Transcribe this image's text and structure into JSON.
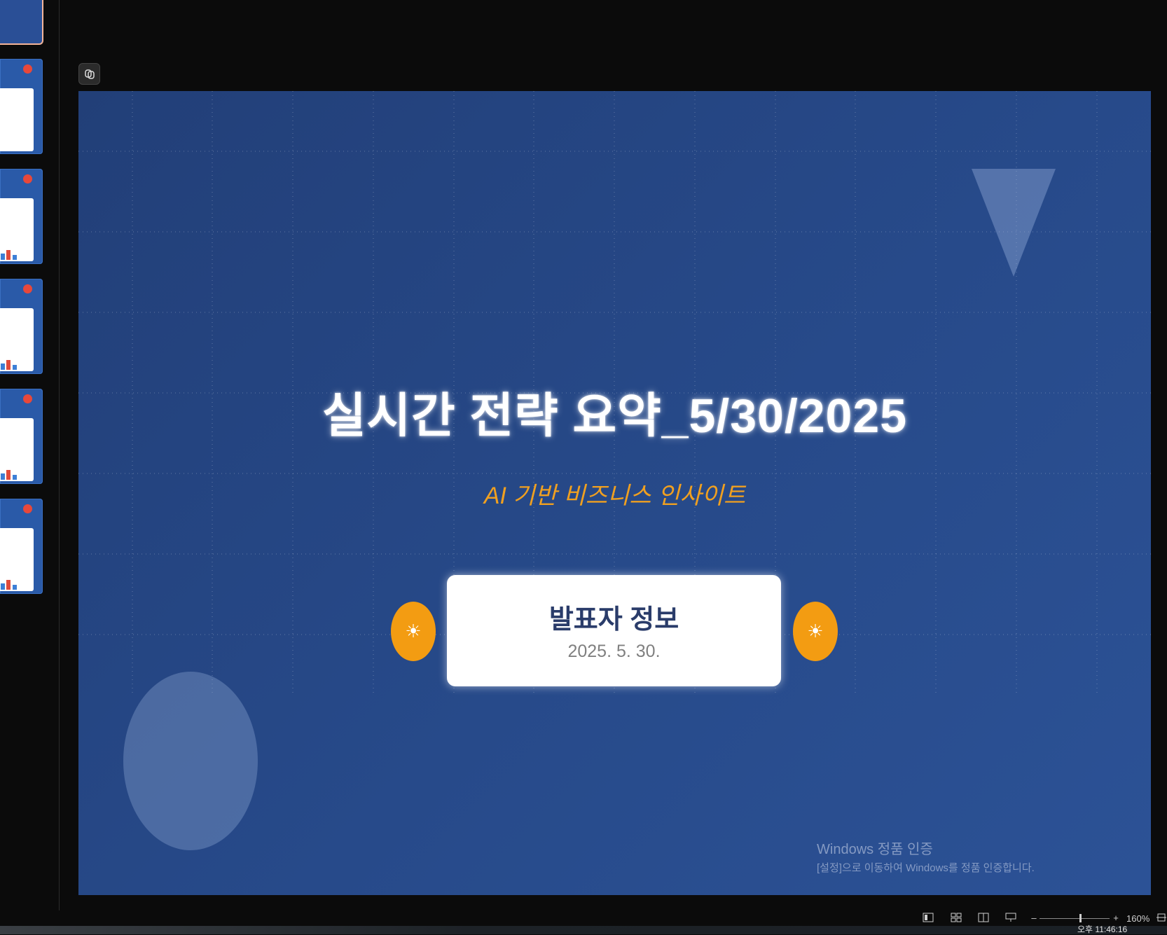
{
  "thumbnails": {
    "count": 6,
    "selected_index": 0
  },
  "copilot": {
    "icon": "copilot-icon"
  },
  "slide": {
    "title": "실시간 전략 요약_5/30/2025",
    "subtitle": "AI 기반 비즈니스 인사이트",
    "presenter": "발표자 정보",
    "date": "2025. 5. 30.",
    "sun_icon": "☀",
    "colors": {
      "background": "#264a8a",
      "accent": "#f39c12",
      "card": "#ffffff"
    }
  },
  "watermark": {
    "line1": "Windows 정품 인증",
    "line2": "[설정]으로 이동하여 Windows를 정품 인증합니다."
  },
  "statusbar": {
    "zoom_minus": "–",
    "zoom_plus": "+",
    "zoom_level": "160%",
    "zoom_value_percent": 160
  },
  "taskbar": {
    "clock": "오후 11:46:16"
  }
}
